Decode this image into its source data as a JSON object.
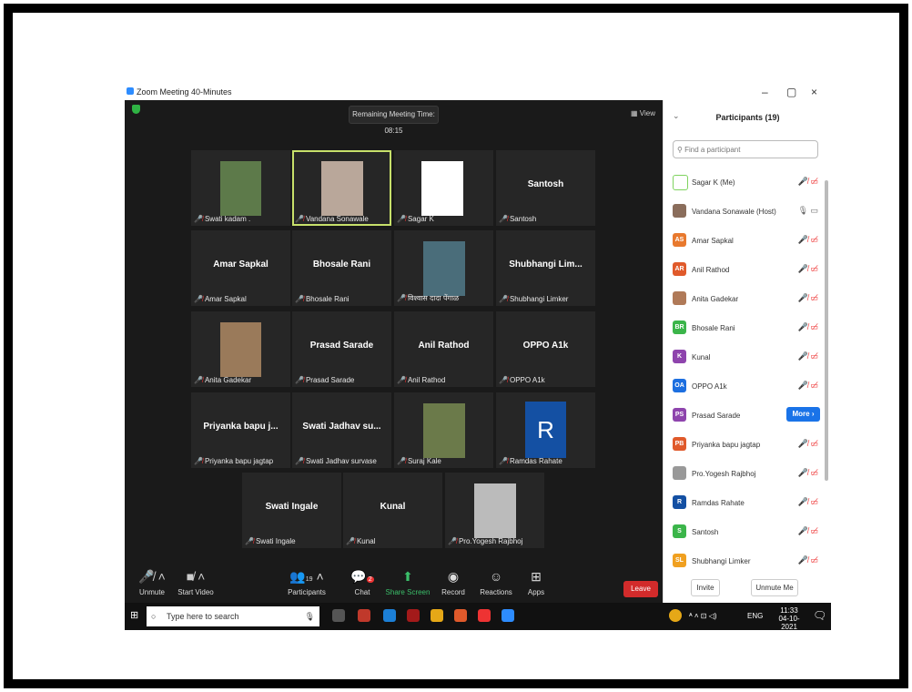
{
  "window": {
    "title": "Zoom Meeting 40-Minutes",
    "controls": [
      "–",
      "▢",
      "×"
    ]
  },
  "meeting": {
    "timer": "Remaining Meeting Time: 08:15",
    "view_label": "View"
  },
  "tiles": [
    {
      "caption": "Swati kadam .",
      "big": "",
      "photo": true
    },
    {
      "caption": "Vandana Sonawale",
      "big": "",
      "photo": true,
      "active": true
    },
    {
      "caption": "Sagar K",
      "big": "",
      "photo": true
    },
    {
      "caption": "Santosh",
      "big": "Santosh"
    },
    {
      "caption": "Amar Sapkal",
      "big": "Amar Sapkal"
    },
    {
      "caption": "Bhosale Rani",
      "big": "Bhosale Rani"
    },
    {
      "caption": "विश्वास दादा पेंगाळ",
      "big": "",
      "photo": true
    },
    {
      "caption": "Shubhangi Limker",
      "big": "Shubhangi  Lim..."
    },
    {
      "caption": "Anita Gadekar",
      "big": "",
      "photo": true
    },
    {
      "caption": "Prasad Sarade",
      "big": "Prasad Sarade"
    },
    {
      "caption": "Anil Rathod",
      "big": "Anil Rathod"
    },
    {
      "caption": "OPPO A1k",
      "big": "OPPO A1k"
    },
    {
      "caption": "Priyanka bapu jagtap",
      "big": "Priyanka bapu  j..."
    },
    {
      "caption": "Swati Jadhav survase",
      "big": "Swati Jadhav su..."
    },
    {
      "caption": "Suraj Kale",
      "big": "",
      "photo": true
    },
    {
      "caption": "Ramdas Rahate",
      "big": "",
      "avatar_letter": "R"
    },
    {
      "caption": "Swati Ingale",
      "big": "Swati Ingale"
    },
    {
      "caption": "Kunal",
      "big": "Kunal"
    },
    {
      "caption": "Pro.Yogesh Rajbhoj",
      "big": "",
      "photo": true
    }
  ],
  "toolbar": {
    "unmute": "Unmute",
    "start_video": "Start Video",
    "participants": "Participants",
    "participants_count": "19",
    "chat": "Chat",
    "chat_badge": "2",
    "share_screen": "Share Screen",
    "record": "Record",
    "reactions": "Reactions",
    "apps": "Apps",
    "leave": "Leave"
  },
  "panel": {
    "title": "Participants (19)",
    "search_placeholder": "Find a participant",
    "more": "More ›",
    "invite": "Invite",
    "unmute_me": "Unmute Me",
    "participants": [
      {
        "initials": "",
        "name": "Sagar K (Me)",
        "color": "#ffffff",
        "icons": "🎤̸ ▭̸"
      },
      {
        "initials": "",
        "name": "Vandana Sonawale (Host)",
        "color": "#8a6d5b",
        "icons": "🎙 ▭"
      },
      {
        "initials": "AS",
        "name": "Amar Sapkal",
        "color": "#e8792e",
        "icons": "🎤̸ ▭̸"
      },
      {
        "initials": "AR",
        "name": "Anil Rathod",
        "color": "#e05a2b",
        "icons": "🎤̸ ▭̸"
      },
      {
        "initials": "",
        "name": "Anita Gadekar",
        "color": "#b07a58",
        "icons": "🎤̸ ▭̸"
      },
      {
        "initials": "BR",
        "name": "Bhosale Rani",
        "color": "#3bb54a",
        "icons": "🎤̸ ▭̸"
      },
      {
        "initials": "K",
        "name": "Kunal",
        "color": "#8e44ad",
        "icons": "🎤̸ ▭̸"
      },
      {
        "initials": "OA",
        "name": "OPPO A1k",
        "color": "#1d6fe0",
        "icons": "🎤̸ ▭̸"
      },
      {
        "initials": "PS",
        "name": "Prasad Sarade",
        "color": "#8e44ad",
        "icons": ""
      },
      {
        "initials": "PB",
        "name": "Priyanka bapu  jagtap",
        "color": "#e05a2b",
        "icons": "🎤̸ ▭̸"
      },
      {
        "initials": "",
        "name": "Pro.Yogesh Rajbhoj",
        "color": "#999999",
        "icons": "🎤̸ ▭̸"
      },
      {
        "initials": "R",
        "name": "Ramdas Rahate",
        "color": "#1450a3",
        "icons": "🎤̸ ▭̸"
      },
      {
        "initials": "S",
        "name": "Santosh",
        "color": "#3bb54a",
        "icons": "🎤̸ ▭̸"
      },
      {
        "initials": "SL",
        "name": "Shubhangi  Limker",
        "color": "#f0a020",
        "icons": "🎤̸ ▭̸"
      }
    ]
  },
  "taskbar": {
    "search_placeholder": "Type here to search",
    "lang": "ENG",
    "time": "11:33",
    "date": "04-10-2021"
  }
}
